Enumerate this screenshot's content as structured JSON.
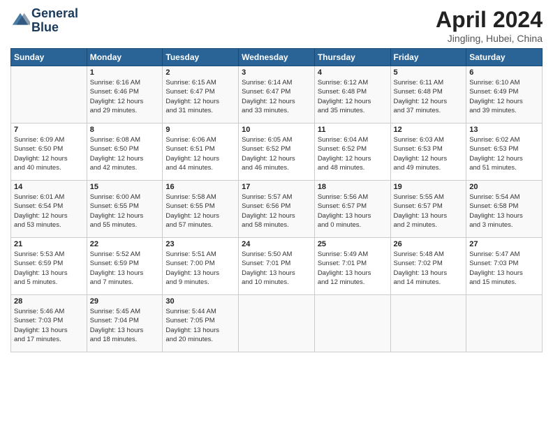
{
  "header": {
    "logo_line1": "General",
    "logo_line2": "Blue",
    "title": "April 2024",
    "location": "Jingling, Hubei, China"
  },
  "days_of_week": [
    "Sunday",
    "Monday",
    "Tuesday",
    "Wednesday",
    "Thursday",
    "Friday",
    "Saturday"
  ],
  "weeks": [
    [
      {
        "day": "",
        "info": ""
      },
      {
        "day": "1",
        "info": "Sunrise: 6:16 AM\nSunset: 6:46 PM\nDaylight: 12 hours\nand 29 minutes."
      },
      {
        "day": "2",
        "info": "Sunrise: 6:15 AM\nSunset: 6:47 PM\nDaylight: 12 hours\nand 31 minutes."
      },
      {
        "day": "3",
        "info": "Sunrise: 6:14 AM\nSunset: 6:47 PM\nDaylight: 12 hours\nand 33 minutes."
      },
      {
        "day": "4",
        "info": "Sunrise: 6:12 AM\nSunset: 6:48 PM\nDaylight: 12 hours\nand 35 minutes."
      },
      {
        "day": "5",
        "info": "Sunrise: 6:11 AM\nSunset: 6:48 PM\nDaylight: 12 hours\nand 37 minutes."
      },
      {
        "day": "6",
        "info": "Sunrise: 6:10 AM\nSunset: 6:49 PM\nDaylight: 12 hours\nand 39 minutes."
      }
    ],
    [
      {
        "day": "7",
        "info": "Sunrise: 6:09 AM\nSunset: 6:50 PM\nDaylight: 12 hours\nand 40 minutes."
      },
      {
        "day": "8",
        "info": "Sunrise: 6:08 AM\nSunset: 6:50 PM\nDaylight: 12 hours\nand 42 minutes."
      },
      {
        "day": "9",
        "info": "Sunrise: 6:06 AM\nSunset: 6:51 PM\nDaylight: 12 hours\nand 44 minutes."
      },
      {
        "day": "10",
        "info": "Sunrise: 6:05 AM\nSunset: 6:52 PM\nDaylight: 12 hours\nand 46 minutes."
      },
      {
        "day": "11",
        "info": "Sunrise: 6:04 AM\nSunset: 6:52 PM\nDaylight: 12 hours\nand 48 minutes."
      },
      {
        "day": "12",
        "info": "Sunrise: 6:03 AM\nSunset: 6:53 PM\nDaylight: 12 hours\nand 49 minutes."
      },
      {
        "day": "13",
        "info": "Sunrise: 6:02 AM\nSunset: 6:53 PM\nDaylight: 12 hours\nand 51 minutes."
      }
    ],
    [
      {
        "day": "14",
        "info": "Sunrise: 6:01 AM\nSunset: 6:54 PM\nDaylight: 12 hours\nand 53 minutes."
      },
      {
        "day": "15",
        "info": "Sunrise: 6:00 AM\nSunset: 6:55 PM\nDaylight: 12 hours\nand 55 minutes."
      },
      {
        "day": "16",
        "info": "Sunrise: 5:58 AM\nSunset: 6:55 PM\nDaylight: 12 hours\nand 57 minutes."
      },
      {
        "day": "17",
        "info": "Sunrise: 5:57 AM\nSunset: 6:56 PM\nDaylight: 12 hours\nand 58 minutes."
      },
      {
        "day": "18",
        "info": "Sunrise: 5:56 AM\nSunset: 6:57 PM\nDaylight: 13 hours\nand 0 minutes."
      },
      {
        "day": "19",
        "info": "Sunrise: 5:55 AM\nSunset: 6:57 PM\nDaylight: 13 hours\nand 2 minutes."
      },
      {
        "day": "20",
        "info": "Sunrise: 5:54 AM\nSunset: 6:58 PM\nDaylight: 13 hours\nand 3 minutes."
      }
    ],
    [
      {
        "day": "21",
        "info": "Sunrise: 5:53 AM\nSunset: 6:59 PM\nDaylight: 13 hours\nand 5 minutes."
      },
      {
        "day": "22",
        "info": "Sunrise: 5:52 AM\nSunset: 6:59 PM\nDaylight: 13 hours\nand 7 minutes."
      },
      {
        "day": "23",
        "info": "Sunrise: 5:51 AM\nSunset: 7:00 PM\nDaylight: 13 hours\nand 9 minutes."
      },
      {
        "day": "24",
        "info": "Sunrise: 5:50 AM\nSunset: 7:01 PM\nDaylight: 13 hours\nand 10 minutes."
      },
      {
        "day": "25",
        "info": "Sunrise: 5:49 AM\nSunset: 7:01 PM\nDaylight: 13 hours\nand 12 minutes."
      },
      {
        "day": "26",
        "info": "Sunrise: 5:48 AM\nSunset: 7:02 PM\nDaylight: 13 hours\nand 14 minutes."
      },
      {
        "day": "27",
        "info": "Sunrise: 5:47 AM\nSunset: 7:03 PM\nDaylight: 13 hours\nand 15 minutes."
      }
    ],
    [
      {
        "day": "28",
        "info": "Sunrise: 5:46 AM\nSunset: 7:03 PM\nDaylight: 13 hours\nand 17 minutes."
      },
      {
        "day": "29",
        "info": "Sunrise: 5:45 AM\nSunset: 7:04 PM\nDaylight: 13 hours\nand 18 minutes."
      },
      {
        "day": "30",
        "info": "Sunrise: 5:44 AM\nSunset: 7:05 PM\nDaylight: 13 hours\nand 20 minutes."
      },
      {
        "day": "",
        "info": ""
      },
      {
        "day": "",
        "info": ""
      },
      {
        "day": "",
        "info": ""
      },
      {
        "day": "",
        "info": ""
      }
    ]
  ]
}
